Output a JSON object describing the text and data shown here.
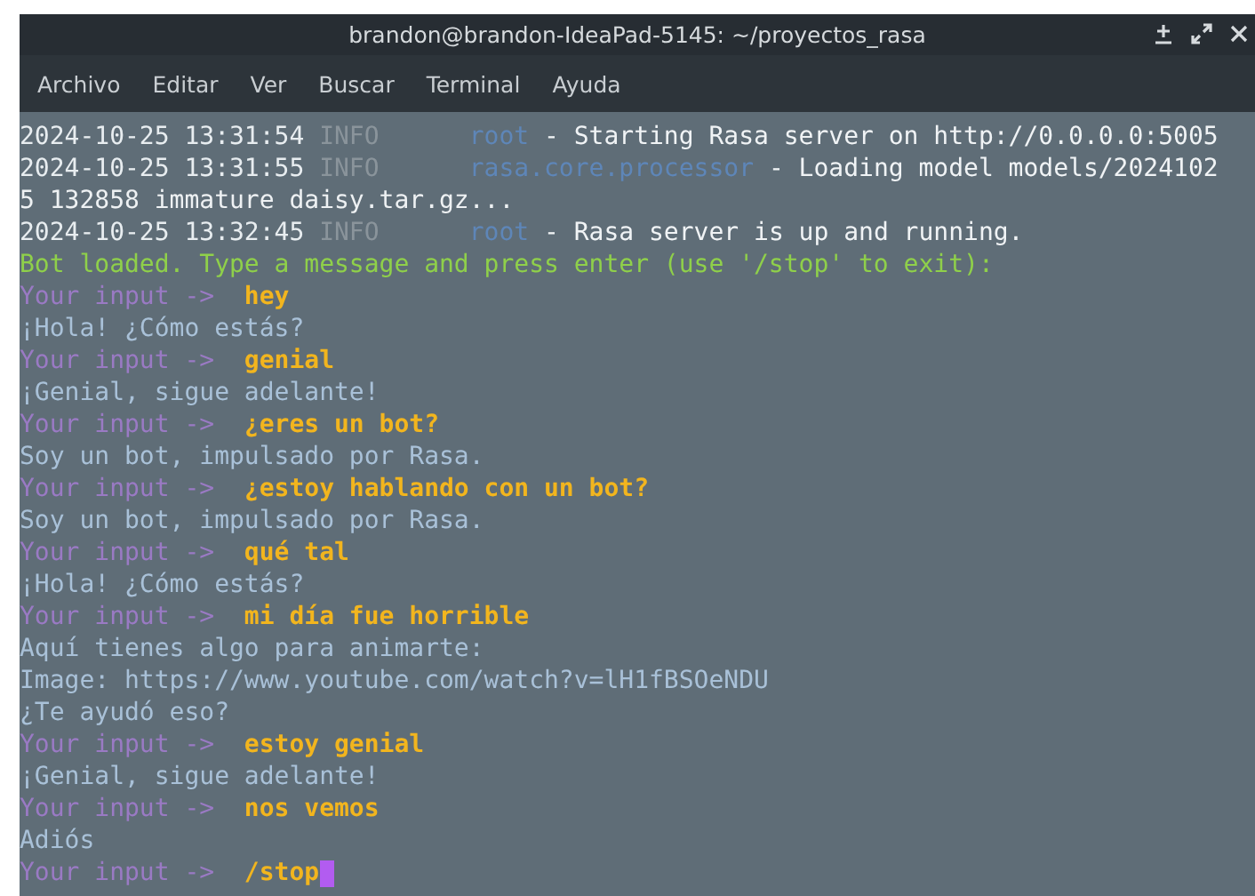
{
  "window": {
    "title": "brandon@brandon-IdeaPad-5145: ~/proyectos_rasa"
  },
  "menu": [
    "Archivo",
    "Editar",
    "Ver",
    "Buscar",
    "Terminal",
    "Ayuda"
  ],
  "terminal": {
    "cursor_visible": true,
    "lines": [
      {
        "kind": "log",
        "time": "2024-10-25 13:31:54",
        "level": "INFO",
        "logger": "root",
        "message": " - Starting Rasa server on http://0.0.0.0:5005"
      },
      {
        "kind": "log",
        "time": "2024-10-25 13:31:55",
        "level": "INFO",
        "logger": "rasa.core.processor",
        "message": " - Loading model models/2024102"
      },
      {
        "kind": "wrap",
        "text": "5 132858 immature daisy.tar.gz..."
      },
      {
        "kind": "log",
        "time": "2024-10-25 13:32:45",
        "level": "INFO",
        "logger": "root",
        "message": " - Rasa server is up and running."
      },
      {
        "kind": "status",
        "text": "Bot loaded. Type a message and press enter (use '/stop' to exit):"
      },
      {
        "kind": "prompt",
        "label": "Your input ->",
        "input": "hey"
      },
      {
        "kind": "reply",
        "text": "¡Hola! ¿Cómo estás?"
      },
      {
        "kind": "prompt",
        "label": "Your input ->",
        "input": "genial"
      },
      {
        "kind": "reply",
        "text": "¡Genial, sigue adelante!"
      },
      {
        "kind": "prompt",
        "label": "Your input ->",
        "input": "¿eres un bot?"
      },
      {
        "kind": "reply",
        "text": "Soy un bot, impulsado por Rasa."
      },
      {
        "kind": "prompt",
        "label": "Your input ->",
        "input": "¿estoy hablando con un bot?"
      },
      {
        "kind": "reply",
        "text": "Soy un bot, impulsado por Rasa."
      },
      {
        "kind": "prompt",
        "label": "Your input ->",
        "input": "qué tal"
      },
      {
        "kind": "reply",
        "text": "¡Hola! ¿Cómo estás?"
      },
      {
        "kind": "prompt",
        "label": "Your input ->",
        "input": "mi día fue horrible"
      },
      {
        "kind": "reply",
        "text": "Aquí tienes algo para animarte:"
      },
      {
        "kind": "reply",
        "text": "Image: https://www.youtube.com/watch?v=lH1fBSOeNDU"
      },
      {
        "kind": "reply",
        "text": "¿Te ayudó eso?"
      },
      {
        "kind": "prompt",
        "label": "Your input ->",
        "input": "estoy genial"
      },
      {
        "kind": "reply",
        "text": "¡Genial, sigue adelante!"
      },
      {
        "kind": "prompt",
        "label": "Your input ->",
        "input": "nos vemos"
      },
      {
        "kind": "reply",
        "text": "Adiós"
      },
      {
        "kind": "prompt",
        "label": "Your input ->",
        "input": "/stop"
      }
    ]
  }
}
